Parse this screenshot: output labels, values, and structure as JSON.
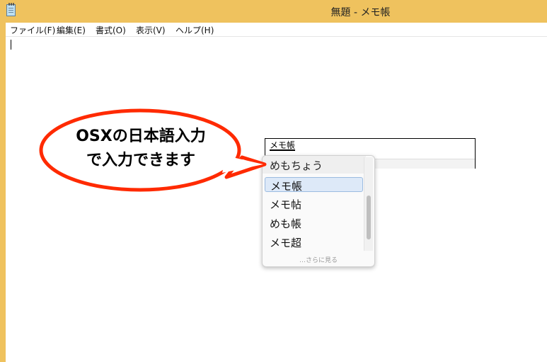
{
  "window": {
    "title": "無題 - メモ帳",
    "icon": "notepad-icon"
  },
  "menu": {
    "items": [
      {
        "label": "ファイル(F)"
      },
      {
        "label": "編集(E)"
      },
      {
        "label": "書式(O)"
      },
      {
        "label": "表示(V)"
      },
      {
        "label": "ヘルプ(H)"
      }
    ]
  },
  "ime": {
    "composition": "メモ帳",
    "header": "めもちょう",
    "candidates": [
      "メモ帳",
      "メモ帖",
      "めも帳",
      "メモ超"
    ],
    "selected_index": 0,
    "more_label": "…さらに見る"
  },
  "callout": {
    "line1": "OSXの日本語入力",
    "line2": "で入力できます"
  },
  "colors": {
    "titlebar": "#efc25e",
    "bubble_border": "#ff2a00",
    "selection": "#dde9f8"
  }
}
